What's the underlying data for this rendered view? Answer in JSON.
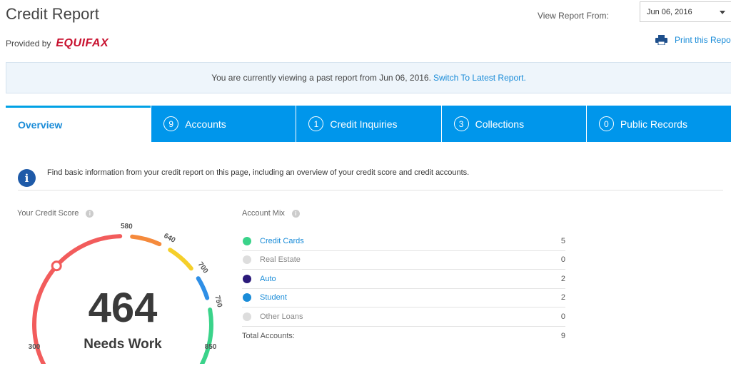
{
  "header": {
    "title": "Credit Report",
    "provided_by_label": "Provided by",
    "provider_logo_text": "EQUIFAX",
    "provider_logo_color": "#c8102e",
    "view_report_from_label": "View Report From:",
    "selected_date": "Jun 06, 2016",
    "print_label": "Print this Report",
    "link_color": "#1a8cd8"
  },
  "banner": {
    "text": "You are currently viewing a past report from Jun 06, 2016.",
    "link": "Switch To Latest Report."
  },
  "tabs": [
    {
      "label": "Overview",
      "count": null
    },
    {
      "label": "Accounts",
      "count": "9"
    },
    {
      "label": "Credit Inquiries",
      "count": "1"
    },
    {
      "label": "Collections",
      "count": "3"
    },
    {
      "label": "Public Records",
      "count": "0"
    }
  ],
  "tab_color": "#0096eb",
  "info": {
    "icon": "info-icon",
    "text": "Find basic information from your credit report on this page, including an overview of your credit score and credit accounts."
  },
  "score": {
    "label": "Your Credit Score",
    "value": "464",
    "rating": "Needs Work",
    "min": "300",
    "max": "850",
    "ticks": [
      "580",
      "640",
      "700",
      "750"
    ],
    "segment_colors": [
      "#f25c5c",
      "#f58a3c",
      "#f5cf2a",
      "#2f8fe6",
      "#3ad38a"
    ]
  },
  "account_mix": {
    "label": "Account Mix",
    "items": [
      {
        "name": "Credit Cards",
        "count": "5",
        "color": "#3ad38a",
        "linked": true
      },
      {
        "name": "Real Estate",
        "count": "0",
        "color": "#dddddd",
        "linked": false
      },
      {
        "name": "Auto",
        "count": "2",
        "color": "#2b1a7a",
        "linked": true
      },
      {
        "name": "Student",
        "count": "2",
        "color": "#1a8cd8",
        "linked": true
      },
      {
        "name": "Other Loans",
        "count": "0",
        "color": "#dddddd",
        "linked": false
      }
    ],
    "total_label": "Total Accounts:",
    "total_count": "9"
  }
}
